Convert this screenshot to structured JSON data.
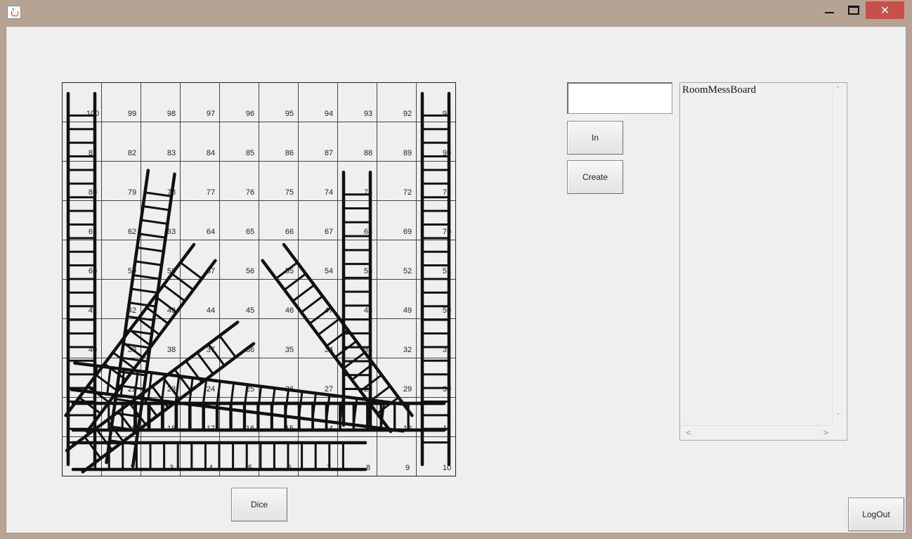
{
  "window": {
    "close_symbol": "✕",
    "icons": [
      "java-app-icon",
      "minimize-icon",
      "maximize-icon",
      "close-icon"
    ]
  },
  "board": {
    "numbers": [
      100,
      99,
      98,
      97,
      96,
      95,
      94,
      93,
      92,
      91,
      81,
      82,
      83,
      84,
      85,
      86,
      87,
      88,
      89,
      90,
      80,
      79,
      78,
      77,
      76,
      75,
      74,
      73,
      72,
      71,
      61,
      62,
      63,
      64,
      65,
      66,
      67,
      68,
      69,
      70,
      60,
      59,
      58,
      57,
      56,
      55,
      54,
      53,
      52,
      51,
      41,
      42,
      43,
      44,
      45,
      46,
      47,
      48,
      49,
      50,
      40,
      39,
      38,
      37,
      36,
      35,
      34,
      33,
      32,
      31,
      21,
      22,
      23,
      24,
      25,
      26,
      27,
      28,
      29,
      30,
      20,
      19,
      18,
      17,
      16,
      15,
      14,
      13,
      12,
      11,
      1,
      2,
      3,
      4,
      5,
      6,
      7,
      8,
      9,
      10
    ],
    "ladders": [
      {
        "from": 1,
        "to": 100
      },
      {
        "from": 10,
        "to": 91
      },
      {
        "from": 2,
        "to": 78
      },
      {
        "from": 20,
        "to": 57
      },
      {
        "from": 13,
        "to": 73
      },
      {
        "from": 12,
        "to": 55
      },
      {
        "from": 1,
        "to": 36
      },
      {
        "from": 1,
        "to": 8
      },
      {
        "from": 19,
        "to": 11
      },
      {
        "from": 20,
        "to": 11
      },
      {
        "from": 21,
        "to": 12
      }
    ]
  },
  "controls": {
    "room_input_value": "",
    "in_label": "In",
    "create_label": "Create",
    "dice_label": "Dice",
    "logout_label": "LogOut"
  },
  "message_board": {
    "text": "RoomMessBoard",
    "scroll_up": "˄",
    "scroll_down": "˅",
    "scroll_left": "<",
    "scroll_right": ">"
  }
}
